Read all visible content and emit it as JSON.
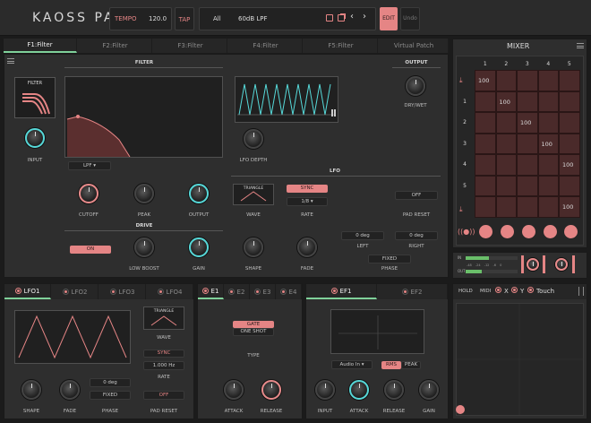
{
  "app": {
    "logo": "KAOSS PAD",
    "tempo_label": "TEMPO",
    "tempo_value": "120.0",
    "tap": "TAP",
    "bank": "All",
    "preset": "60dB LPF",
    "edit": "EDIT",
    "undo": "Undo"
  },
  "tabs": [
    "F1:Filter",
    "F2:Filter",
    "F3:Filter",
    "F4:Filter",
    "F5:Filter",
    "Virtual Patch"
  ],
  "filter": {
    "title": "FILTER",
    "icon_label": "FILTER",
    "input": "INPUT",
    "type_value": "LPF",
    "cutoff": "CUTOFF",
    "peak": "PEAK",
    "output_knob": "OUTPUT",
    "output_title": "OUTPUT",
    "dry_wet": "DRY/WET",
    "lfo_depth": "LFO DEPTH"
  },
  "lfo": {
    "title": "LFO",
    "wave_value": "TRIANGLE",
    "wave": "WAVE",
    "sync": "SYNC",
    "rate_value": "1/8",
    "rate": "RATE",
    "pad_reset_value": "OFF",
    "pad_reset": "PAD RESET",
    "shape": "SHAPE",
    "fade": "FADE",
    "left_value": "0 deg",
    "left": "LEFT",
    "right_value": "0 deg",
    "right": "RIGHT",
    "phase_value": "FIXED",
    "phase": "PHASE"
  },
  "drive": {
    "title": "DRIVE",
    "on": "ON",
    "low_boost": "LOW BOOST",
    "gain": "GAIN"
  },
  "mixer": {
    "title": "MIXER",
    "cols": [
      "1",
      "2",
      "3",
      "4",
      "5"
    ],
    "rows": [
      "1",
      "2",
      "3",
      "4",
      "5"
    ],
    "cells": [
      {
        "row": 0,
        "col": 0,
        "value": "100"
      },
      {
        "row": 1,
        "col": 1,
        "value": "100"
      },
      {
        "row": 2,
        "col": 2,
        "value": "100"
      },
      {
        "row": 3,
        "col": 3,
        "value": "100"
      },
      {
        "row": 4,
        "col": 4,
        "value": "100"
      },
      {
        "row": 6,
        "col": 4,
        "value": "100"
      }
    ],
    "meter_labels": [
      "IN",
      "OUT"
    ],
    "meter_scale": [
      "-48",
      "-24",
      "-12",
      "-6",
      "0"
    ]
  },
  "lfo_tabs": [
    "LFO1",
    "LFO2",
    "LFO3",
    "LFO4"
  ],
  "lfo_section": {
    "wave_value": "TRIANGLE",
    "wave": "WAVE",
    "sync": "SYNC",
    "rate_value": "1.000 Hz",
    "rate": "RATE",
    "shape": "SHAPE",
    "fade": "FADE",
    "phase_value": "0 deg",
    "phase_mode": "FIXED",
    "phase": "PHASE",
    "pad_reset_value": "OFF",
    "pad_reset": "PAD RESET"
  },
  "env_tabs": [
    "E1",
    "E2",
    "E3",
    "E4"
  ],
  "env": {
    "gate": "GATE",
    "one_shot": "ONE SHOT",
    "type": "TYPE",
    "attack": "ATTACK",
    "release": "RELEASE"
  },
  "ef_tabs": [
    "EF1",
    "EF2"
  ],
  "ef": {
    "source": "Audio In",
    "rms": "RMS",
    "peak": "PEAK",
    "input": "INPUT",
    "attack": "ATTACK",
    "release": "RELEASE",
    "gain": "GAIN"
  },
  "pad": {
    "hold": "HOLD",
    "midi": "MIDI",
    "x": "X",
    "y": "Y",
    "touch": "Touch"
  }
}
